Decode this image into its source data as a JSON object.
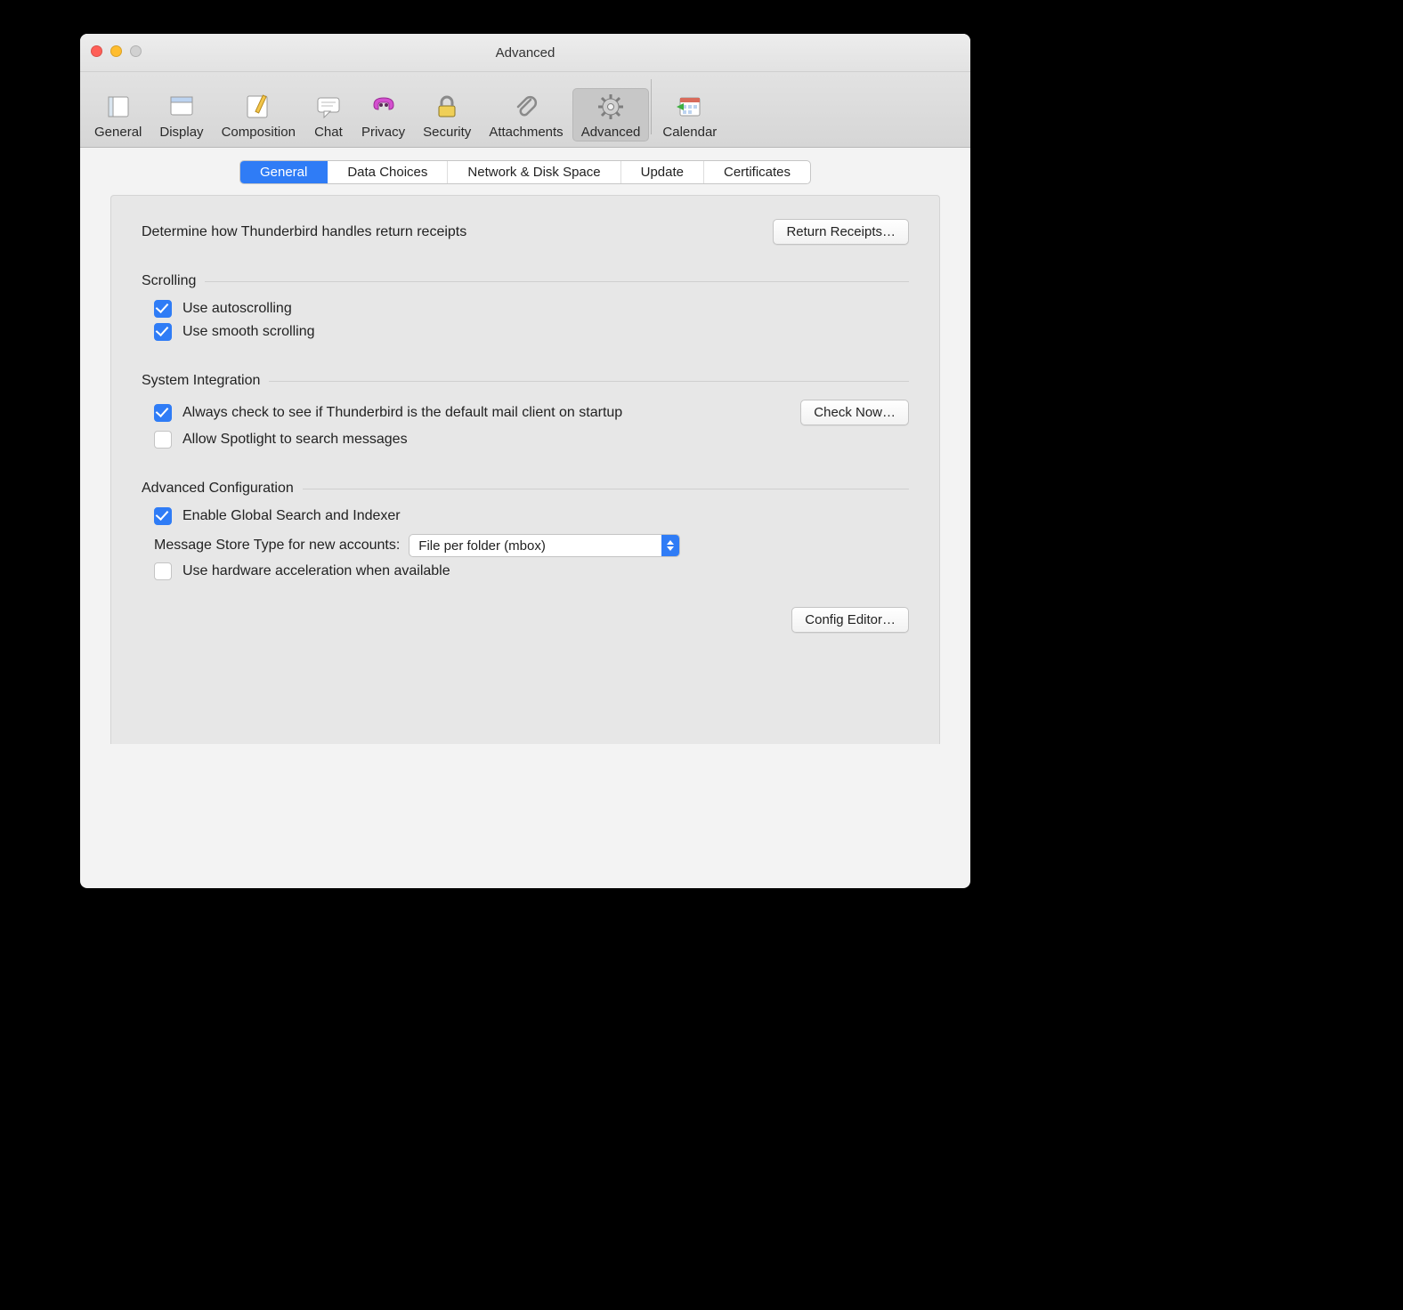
{
  "window": {
    "title": "Advanced"
  },
  "toolbar": [
    {
      "id": "general",
      "label": "General",
      "active": false
    },
    {
      "id": "display",
      "label": "Display",
      "active": false
    },
    {
      "id": "composition",
      "label": "Composition",
      "active": false
    },
    {
      "id": "chat",
      "label": "Chat",
      "active": false
    },
    {
      "id": "privacy",
      "label": "Privacy",
      "active": false
    },
    {
      "id": "security",
      "label": "Security",
      "active": false
    },
    {
      "id": "attachments",
      "label": "Attachments",
      "active": false
    },
    {
      "id": "advanced",
      "label": "Advanced",
      "active": true
    },
    {
      "id": "calendar",
      "label": "Calendar",
      "active": false
    }
  ],
  "subtabs": [
    {
      "id": "general2",
      "label": "General",
      "active": true
    },
    {
      "id": "datachoices",
      "label": "Data Choices",
      "active": false
    },
    {
      "id": "network",
      "label": "Network & Disk Space",
      "active": false
    },
    {
      "id": "update",
      "label": "Update",
      "active": false
    },
    {
      "id": "certificates",
      "label": "Certificates",
      "active": false
    }
  ],
  "content": {
    "return_receipts_desc": "Determine how Thunderbird handles return receipts",
    "return_receipts_btn": "Return Receipts…",
    "scrolling": {
      "title": "Scrolling",
      "autoscroll_label": "Use autoscrolling",
      "autoscroll_checked": true,
      "smooth_label": "Use smooth scrolling",
      "smooth_checked": true
    },
    "sysint": {
      "title": "System Integration",
      "default_check_label": "Always check to see if Thunderbird is the default mail client on startup",
      "default_check_checked": true,
      "check_now_btn": "Check Now…",
      "spotlight_label": "Allow Spotlight to search messages",
      "spotlight_checked": false
    },
    "advcfg": {
      "title": "Advanced Configuration",
      "global_search_label": "Enable Global Search and Indexer",
      "global_search_checked": true,
      "store_type_label": "Message Store Type for new accounts:",
      "store_type_value": "File per folder (mbox)",
      "hw_accel_label": "Use hardware acceleration when available",
      "hw_accel_checked": false,
      "config_editor_btn": "Config Editor…"
    }
  }
}
